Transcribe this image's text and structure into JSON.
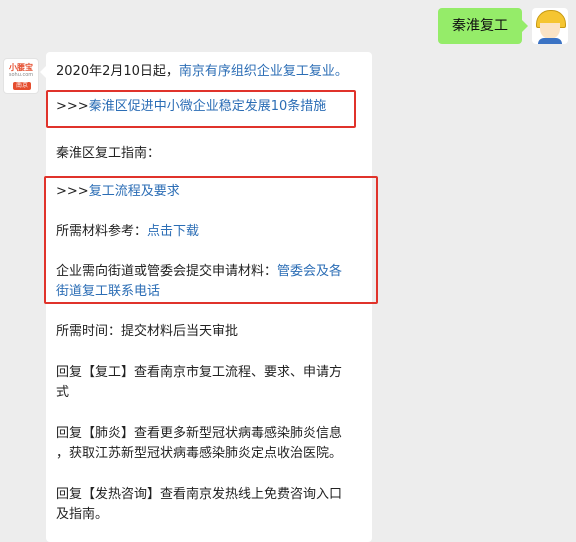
{
  "outgoing": {
    "text": "秦淮复工"
  },
  "sender": {
    "brand": "小腰宝",
    "site": "sohu.com",
    "city": "南京"
  },
  "message": {
    "line1_prefix": "2020年2月10日起，",
    "line1_link": "南京有序组织企业复工复业。",
    "measures_arrows": ">>>",
    "measures_link": "秦淮区促进中小微企业稳定发展10条措施",
    "guide_title": "秦淮区复工指南：",
    "process_arrows": ">>>",
    "process_link": "复工流程及要求",
    "materials_label": "所需材料参考：",
    "materials_link": "点击下载",
    "submit_text": "企业需向街道或管委会提交申请材料：",
    "submit_link_1": "管委会及各",
    "submit_link_2": "街道复工联系电话",
    "time_text": "所需时间：提交材料后当天审批",
    "reply1_line1": "回复【复工】查看南京市复工流程、要求、申请方",
    "reply1_line2": "式",
    "reply2_line1": "回复【肺炎】查看更多新型冠状病毒感染肺炎信息",
    "reply2_line2": "，获取江苏新型冠状病毒感染肺炎定点收治医院。",
    "reply3_line1": "回复【发热咨询】查看南京发热线上免费咨询入口",
    "reply3_line2": "及指南。"
  },
  "colors": {
    "link": "#2b6db5",
    "highlight_box": "#e0332b",
    "outgoing_bubble": "#95ec69"
  }
}
